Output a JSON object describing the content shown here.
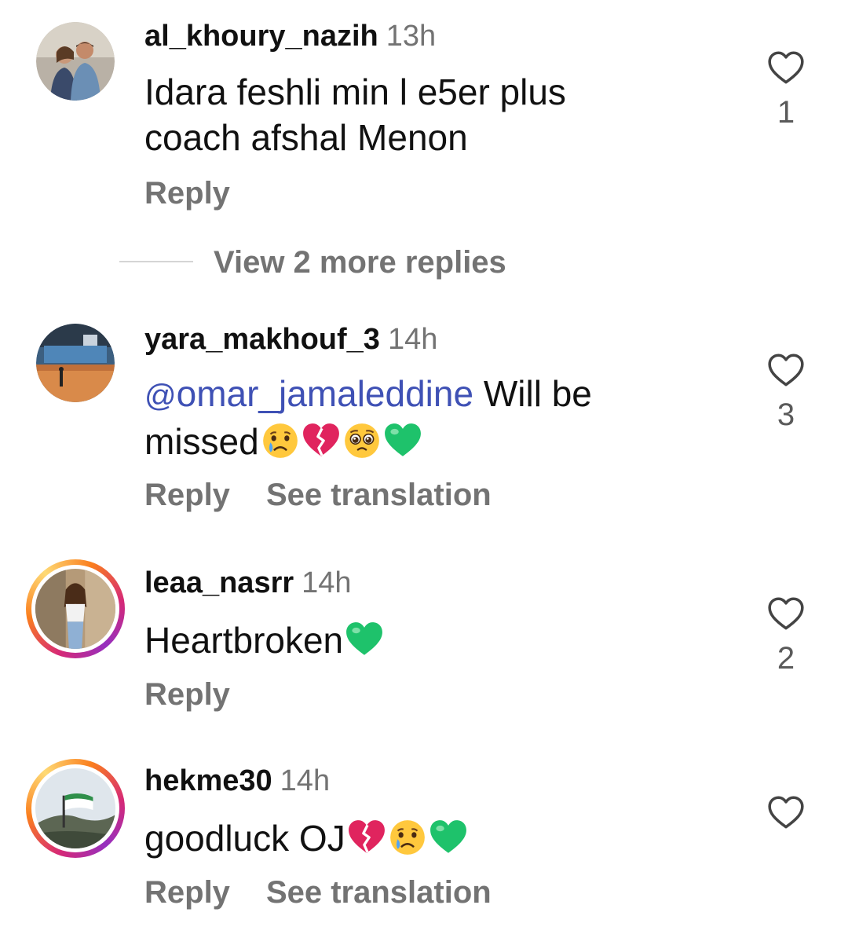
{
  "comments": [
    {
      "username": "al_khoury_nazih",
      "time": "13h",
      "line1": "Idara feshli min l e5er plus",
      "line2": "coach afshal Menon",
      "reply": "Reply",
      "likes": "1"
    },
    {
      "username": "yara_makhouf_3",
      "time": "14h",
      "mention_icon": "@",
      "mention": "omar_jamaleddine",
      "line1_rest": " Will be",
      "line2": "missed",
      "emojis": [
        "crying-face",
        "broken-heart",
        "pleading-face",
        "green-heart"
      ],
      "reply": "Reply",
      "translate": "See translation",
      "likes": "3"
    },
    {
      "username": "leaa_nasrr",
      "time": "14h",
      "line1": "Heartbroken",
      "emojis": [
        "green-heart"
      ],
      "reply": "Reply",
      "likes": "2"
    },
    {
      "username": "hekme30",
      "time": "14h",
      "line1": "goodluck OJ",
      "emojis": [
        "broken-heart",
        "crying-face",
        "green-heart"
      ],
      "reply": "Reply",
      "translate": "See translation"
    }
  ],
  "view_more_replies": "View 2 more replies",
  "colors": {
    "mention": "#3f51b5",
    "secondary_text": "#737373",
    "story_ring": [
      "#d62976",
      "#fa7e1e",
      "#feda75",
      "#962fbf"
    ]
  }
}
